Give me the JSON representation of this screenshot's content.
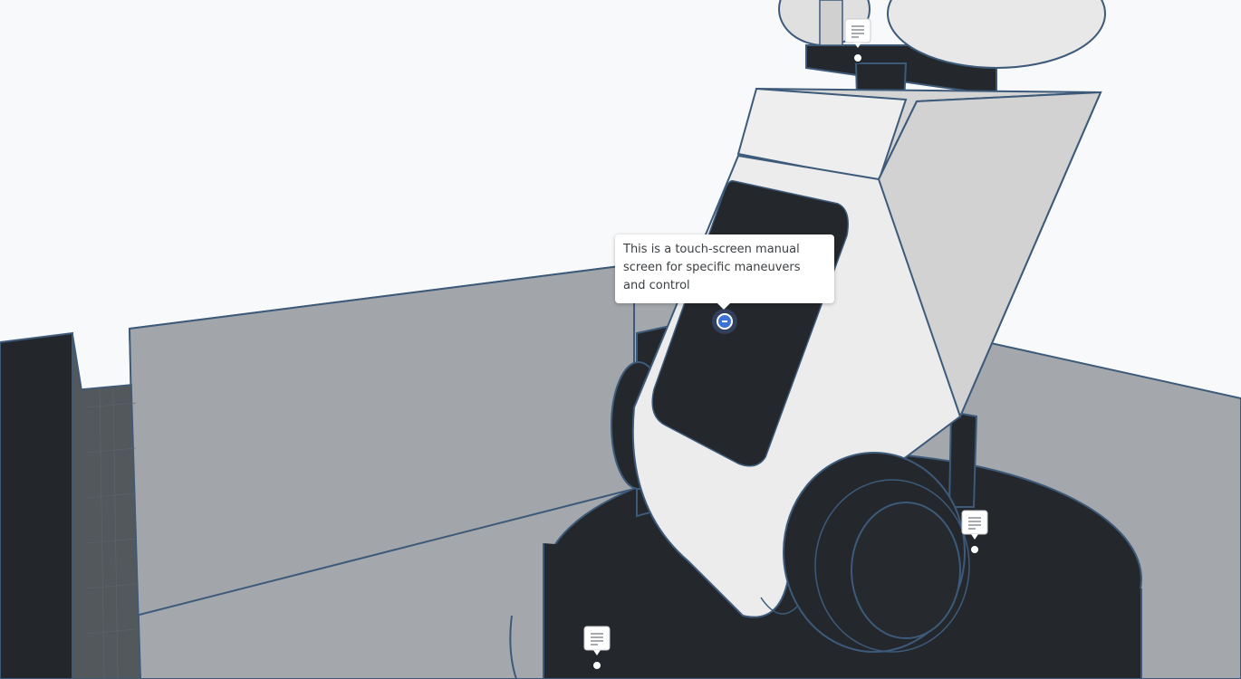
{
  "viewport": {
    "background": "#f8f9fa",
    "model_color": "#2a2e33",
    "edge_color": "#3d5a7a",
    "panel_color": "#a5a9ad",
    "white_part_color": "#ececec"
  },
  "active_note": {
    "text": "This is a touch-screen manual screen for specific maneuvers and control",
    "collapse_icon": "minus-circle-icon"
  },
  "note_pins": [
    {
      "icon": "note-lines-icon",
      "label": "note-pin-top"
    },
    {
      "icon": "note-lines-icon",
      "label": "note-pin-right"
    },
    {
      "icon": "note-lines-icon",
      "label": "note-pin-bottom"
    }
  ]
}
